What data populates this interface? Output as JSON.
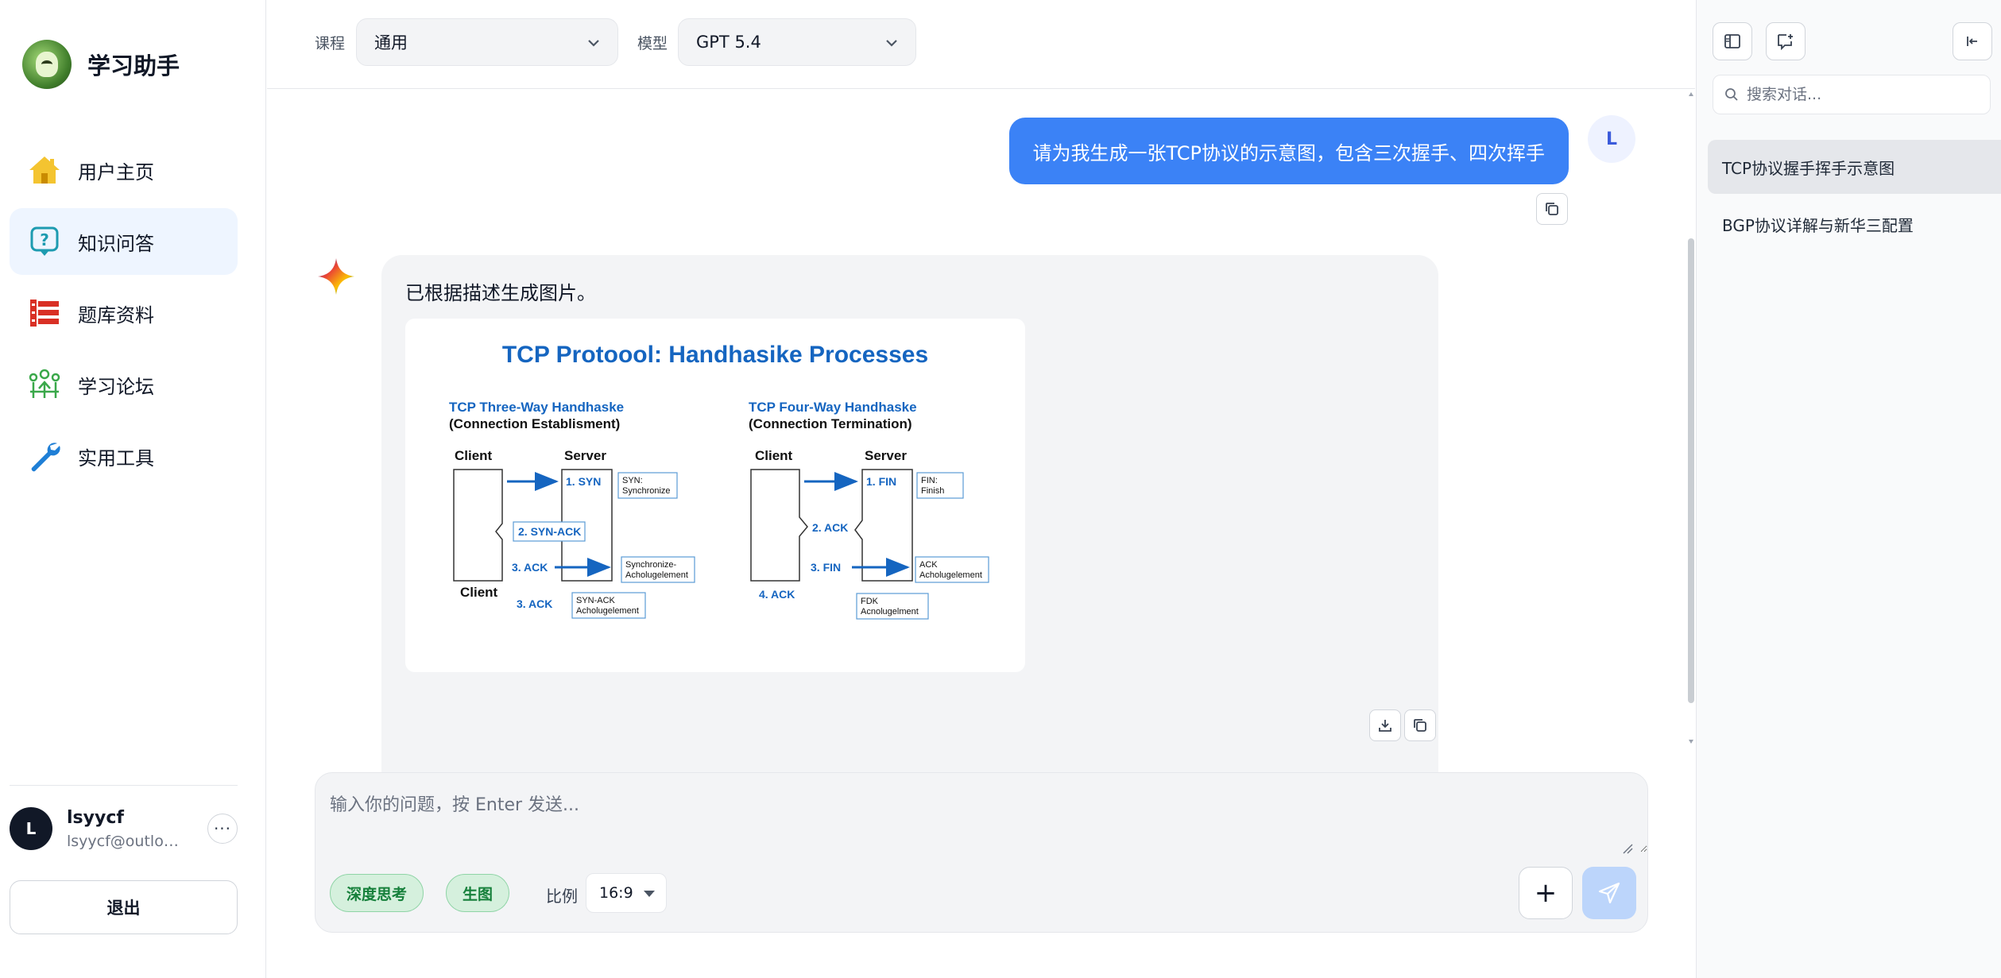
{
  "brand": {
    "title": "学习助手"
  },
  "nav": {
    "items": [
      {
        "label": "用户主页",
        "icon": "home-icon"
      },
      {
        "label": "知识问答",
        "icon": "question-icon",
        "active": true
      },
      {
        "label": "题库资料",
        "icon": "question-bank-icon"
      },
      {
        "label": "学习论坛",
        "icon": "forum-icon"
      },
      {
        "label": "实用工具",
        "icon": "wrench-icon"
      }
    ]
  },
  "user": {
    "initial": "L",
    "name": "lsyycf",
    "email": "lsyycf@outloo…",
    "more": "···",
    "logout": "退出"
  },
  "toolbar": {
    "course_label": "课程",
    "course_value": "通用",
    "model_label": "模型",
    "model_value": "GPT 5.4"
  },
  "chat": {
    "user_initial": "L",
    "user_message": "请为我生成一张TCP协议的示意图，包含三次握手、四次挥手",
    "ai_message": "已根据描述生成图片。",
    "image": {
      "title": "TCP Protoool: Handhasike Processes",
      "left_heading_1": "TCP Three-Way Handhaske",
      "left_heading_2": "(Connection Establisment)",
      "right_heading_1": "TCP Four-Way Handhaske",
      "right_heading_2": "(Connection Termination)",
      "client": "Client",
      "server": "Server",
      "l_syn": "1. SYN",
      "l_syn_note_1": "SYN:",
      "l_syn_note_2": "Synchronize",
      "l_synack": "2. SYN-ACK",
      "l_ack": "3. ACK",
      "l_ack_note_1": "Synchronize-",
      "l_ack_note_2": "Acholugelement",
      "l_ack2": "3. ACK",
      "l_synack_note_1": "SYN-ACK",
      "l_synack_note_2": "Acholugelement",
      "r_fin": "1. FIN",
      "r_fin_note_1": "FIN:",
      "r_fin_note_2": "Finish",
      "r_ack": "2. ACK",
      "r_fin2": "3. FIN",
      "r_ack_note_1": "ACK",
      "r_ack_note_2": "Acholugelement",
      "r_ack4": "4. ACK",
      "r_fdk_note_1": "FDK",
      "r_fdk_note_2": "Acnolugelment"
    }
  },
  "composer": {
    "placeholder": "输入你的问题，按 Enter 发送...",
    "deep_think": "深度思考",
    "gen_image": "生图",
    "ratio_label": "比例",
    "ratio_value": "16:9",
    "plus": "+"
  },
  "history": {
    "search_placeholder": "搜索对话...",
    "items": [
      {
        "title": "TCP协议握手挥手示意图",
        "active": true
      },
      {
        "title": "BGP协议详解与新华三配置"
      }
    ]
  }
}
